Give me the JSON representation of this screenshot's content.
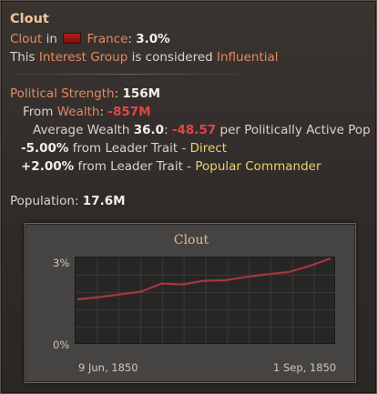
{
  "header": {
    "title": "Clout",
    "clout_label": "Clout",
    "in_word": "in",
    "country": "France",
    "clout_value": "3.0%",
    "this_text": "This",
    "group_text": "Interest Group",
    "considered_text": "is considered",
    "status": "Influential"
  },
  "strength": {
    "label": "Political Strength",
    "value": "156M",
    "from_label": "From",
    "wealth_label": "Wealth",
    "wealth_value": "-857M",
    "avg_label": "Average Wealth",
    "avg_value": "36.0",
    "avg_delta": "-48.57",
    "avg_suffix": "per Politically Active Pop",
    "trait1_value": "-5.00%",
    "trait1_label": "from Leader Trait -",
    "trait1_name": "Direct",
    "trait2_value": "+2.00%",
    "trait2_label": "from Leader Trait -",
    "trait2_name": "Popular Commander"
  },
  "population": {
    "label": "Population",
    "value": "17.6M"
  },
  "chart_data": {
    "type": "line",
    "title": "Clout",
    "x_tick_labels": [
      "9 Jun, 1850",
      "1 Sep, 1850"
    ],
    "y_tick_labels": [
      "3%",
      "0%"
    ],
    "ylim": [
      0,
      3.0
    ],
    "grid": true,
    "line_color": "#a8353d",
    "x": [
      0,
      1,
      2,
      3,
      4,
      5,
      6,
      7,
      8,
      9,
      10,
      11,
      12
    ],
    "values": [
      1.6,
      1.68,
      1.78,
      1.88,
      2.18,
      2.15,
      2.28,
      2.3,
      2.42,
      2.52,
      2.6,
      2.82,
      3.1
    ]
  }
}
